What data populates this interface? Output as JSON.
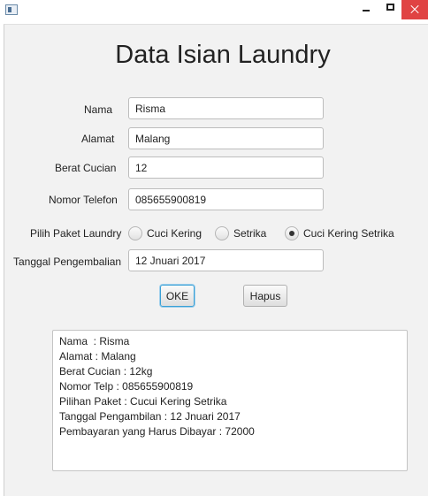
{
  "window": {
    "minimize_icon": "minimize-icon",
    "maximize_icon": "maximize-icon",
    "close_icon": "close-icon"
  },
  "form": {
    "title": "Data Isian Laundry",
    "nama_label": "Nama",
    "nama_value": "Risma",
    "alamat_label": "Alamat",
    "alamat_value": "Malang",
    "berat_label": "Berat Cucian",
    "berat_value": "12",
    "telefon_label": "Nomor Telefon",
    "telefon_value": "085655900819",
    "paket_label": "Pilih Paket Laundry",
    "paket_options": [
      "Cuci Kering",
      "Setrika",
      "Cuci Kering Setrika"
    ],
    "paket_selected": "Cuci Kering Setrika",
    "tanggal_label": "Tanggal Pengembalian",
    "tanggal_value": "12 Jnuari 2017",
    "ok_label": "OKE",
    "hapus_label": "Hapus"
  },
  "output": {
    "lines": [
      "Nama  : Risma",
      "Alamat : Malang",
      "Berat Cucian : 12kg",
      "Nomor Telp : 085655900819",
      "Pilihan Paket : Cucui Kering Setrika",
      "Tanggal Pengambilan : 12 Jnuari 2017",
      "Pembayaran yang Harus Dibayar : 72000"
    ]
  }
}
